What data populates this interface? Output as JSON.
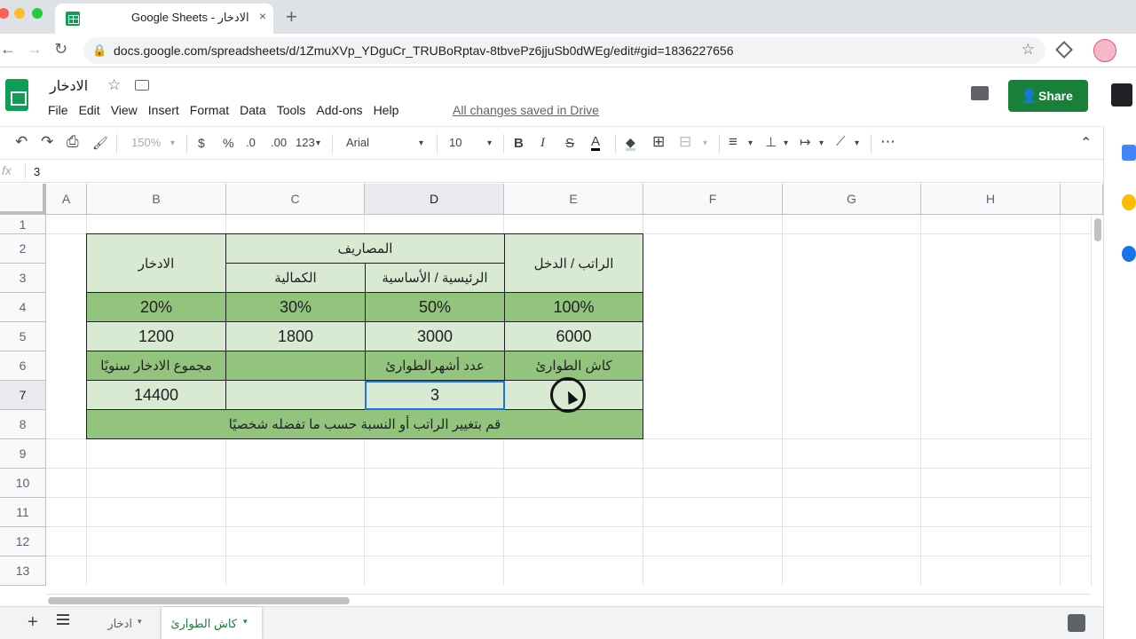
{
  "browser": {
    "tab_title": "Google Sheets - الادخار",
    "url": "docs.google.com/spreadsheets/d/1ZmuXVp_YDguCr_TRUBoRptav-8tbvePz6jjuSb0dWEg/edit#gid=1836227656",
    "close_icon": "×",
    "new_tab_icon": "+",
    "back_icon": "←",
    "forward_icon": "→",
    "reload_icon": "↻",
    "lock_icon": "🔒",
    "bookmark_icon": "☆"
  },
  "app": {
    "doc_title": "الادخار",
    "star_icon": "☆",
    "menus": [
      "File",
      "Edit",
      "View",
      "Insert",
      "Format",
      "Data",
      "Tools",
      "Add-ons",
      "Help"
    ],
    "save_status": "All changes saved in Drive",
    "share_label": "Share",
    "share_icon": "👤"
  },
  "toolbar": {
    "undo": "↶",
    "redo": "↷",
    "print": "⎙",
    "paint_format": "🖌",
    "zoom": "150%",
    "currency": "$",
    "percent": "%",
    "decrease_decimals": ".0",
    "increase_decimals": ".00",
    "more_formats": "123",
    "font": "Arial",
    "font_size": "10",
    "bold": "B",
    "italic": "I",
    "strike": "S",
    "text_color": "A",
    "fill_color": "◆",
    "borders": "⊞",
    "merge": "⊟",
    "h_align": "≡",
    "v_align": "⊥",
    "wrap": "↦",
    "rotate": "⟋",
    "more": "⋯",
    "collapse": "⌃",
    "dropdown_arrow": "▾"
  },
  "formula_bar": {
    "fx": "fx",
    "value": "3"
  },
  "grid": {
    "columns": [
      "A",
      "B",
      "C",
      "D",
      "E",
      "F",
      "G",
      "H"
    ],
    "selected_column": "D",
    "rows": [
      "1",
      "2",
      "3",
      "4",
      "5",
      "6",
      "7",
      "8",
      "9",
      "10",
      "11",
      "12",
      "13"
    ],
    "selected_row": "7"
  },
  "table": {
    "savings_header": "الادخار",
    "expenses_header": "المصاريف",
    "luxury_header": "الكمالية",
    "basic_header": "الرئيسية / الأساسية",
    "income_header": "الراتب / الدخل",
    "savings_pct": "20%",
    "luxury_pct": "30%",
    "basic_pct": "50%",
    "income_pct": "100%",
    "savings_amount": "1200",
    "luxury_amount": "1800",
    "basic_amount": "3000",
    "income_amount": "6000",
    "annual_savings_label": "مجموع الادخار سنويًا",
    "emergency_months_label": "عدد أشهرالطوارئ",
    "emergency_cash_label": "كاش الطوارئ",
    "annual_savings_value": "14400",
    "emergency_months_value": "3",
    "emergency_cash_value": "",
    "footer_note": "قم بتغيير الراتب أو النسبة حسب ما تفضله شخصيًا"
  },
  "sheets": {
    "add_icon": "+",
    "tabs": [
      "ادخار",
      "كاش الطوارئ"
    ],
    "active_index": 1,
    "arrow": "▾"
  },
  "colors": {
    "light_green": "#d9ead3",
    "green": "#93c47d",
    "share_green": "#188038",
    "selection_blue": "#1a73e8"
  }
}
